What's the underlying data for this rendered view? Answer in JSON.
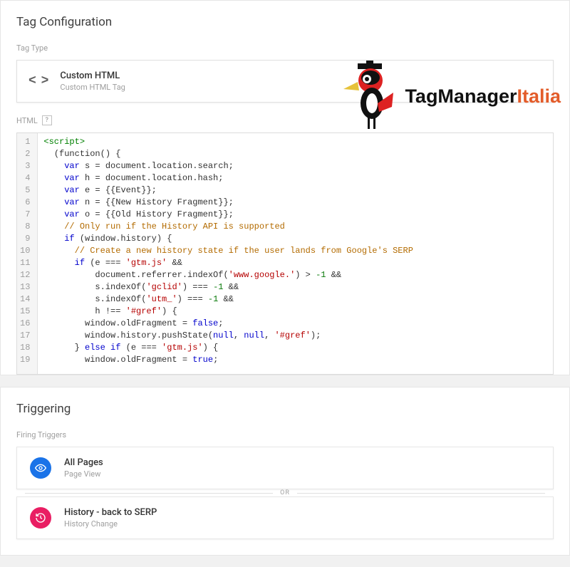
{
  "tag_config": {
    "title": "Tag Configuration",
    "type_label": "Tag Type",
    "type_card": {
      "title": "Custom HTML",
      "subtitle": "Custom HTML Tag"
    },
    "html_label": "HTML",
    "code_lines": [
      [
        {
          "c": "t-tag",
          "t": "<script>"
        }
      ],
      [
        {
          "c": "",
          "t": "  "
        },
        {
          "c": "t-var",
          "t": "(function() {"
        }
      ],
      [
        {
          "c": "",
          "t": "    "
        },
        {
          "c": "t-kw",
          "t": "var"
        },
        {
          "c": "",
          "t": " s = document.location.search;"
        }
      ],
      [
        {
          "c": "",
          "t": "    "
        },
        {
          "c": "t-kw",
          "t": "var"
        },
        {
          "c": "",
          "t": " h = document.location.hash;"
        }
      ],
      [
        {
          "c": "",
          "t": "    "
        },
        {
          "c": "t-kw",
          "t": "var"
        },
        {
          "c": "",
          "t": " e = {{Event}};"
        }
      ],
      [
        {
          "c": "",
          "t": "    "
        },
        {
          "c": "t-kw",
          "t": "var"
        },
        {
          "c": "",
          "t": " n = {{New History Fragment}};"
        }
      ],
      [
        {
          "c": "",
          "t": "    "
        },
        {
          "c": "t-kw",
          "t": "var"
        },
        {
          "c": "",
          "t": " o = {{Old History Fragment}};"
        }
      ],
      [
        {
          "c": "",
          "t": "    "
        },
        {
          "c": "t-cmt",
          "t": "// Only run if the History API is supported"
        }
      ],
      [
        {
          "c": "",
          "t": "    "
        },
        {
          "c": "t-kw",
          "t": "if"
        },
        {
          "c": "",
          "t": " (window.history) {"
        }
      ],
      [
        {
          "c": "",
          "t": "      "
        },
        {
          "c": "t-cmt",
          "t": "// Create a new history state if the user lands from Google's SERP"
        }
      ],
      [
        {
          "c": "",
          "t": "      "
        },
        {
          "c": "t-kw",
          "t": "if"
        },
        {
          "c": "",
          "t": " (e === "
        },
        {
          "c": "t-str",
          "t": "'gtm.js'"
        },
        {
          "c": "",
          "t": " &&"
        }
      ],
      [
        {
          "c": "",
          "t": "          document.referrer.indexOf("
        },
        {
          "c": "t-str",
          "t": "'www.google.'"
        },
        {
          "c": "",
          "t": ") > "
        },
        {
          "c": "t-num",
          "t": "-1"
        },
        {
          "c": "",
          "t": " &&"
        }
      ],
      [
        {
          "c": "",
          "t": "          s.indexOf("
        },
        {
          "c": "t-str",
          "t": "'gclid'"
        },
        {
          "c": "",
          "t": ") === "
        },
        {
          "c": "t-num",
          "t": "-1"
        },
        {
          "c": "",
          "t": " &&"
        }
      ],
      [
        {
          "c": "",
          "t": "          s.indexOf("
        },
        {
          "c": "t-str",
          "t": "'utm_'"
        },
        {
          "c": "",
          "t": ") === "
        },
        {
          "c": "t-num",
          "t": "-1"
        },
        {
          "c": "",
          "t": " &&"
        }
      ],
      [
        {
          "c": "",
          "t": "          h !== "
        },
        {
          "c": "t-str",
          "t": "'#gref'"
        },
        {
          "c": "",
          "t": ") {"
        }
      ],
      [
        {
          "c": "",
          "t": "        window.oldFragment = "
        },
        {
          "c": "t-kw",
          "t": "false"
        },
        {
          "c": "",
          "t": ";"
        }
      ],
      [
        {
          "c": "",
          "t": "        window.history.pushState("
        },
        {
          "c": "t-kw",
          "t": "null"
        },
        {
          "c": "",
          "t": ", "
        },
        {
          "c": "t-kw",
          "t": "null"
        },
        {
          "c": "",
          "t": ", "
        },
        {
          "c": "t-str",
          "t": "'#gref'"
        },
        {
          "c": "",
          "t": ");"
        }
      ],
      [
        {
          "c": "",
          "t": "      } "
        },
        {
          "c": "t-kw",
          "t": "else if"
        },
        {
          "c": "",
          "t": " (e === "
        },
        {
          "c": "t-str",
          "t": "'gtm.js'"
        },
        {
          "c": "",
          "t": ") {"
        }
      ],
      [
        {
          "c": "",
          "t": "        window.oldFragment = "
        },
        {
          "c": "t-kw",
          "t": "true"
        },
        {
          "c": "",
          "t": ";"
        }
      ]
    ]
  },
  "watermark": {
    "text1": "TagManager",
    "text2": "Italia"
  },
  "triggering": {
    "title": "Triggering",
    "firing_label": "Firing Triggers",
    "or_label": "OR",
    "items": [
      {
        "name": "All Pages",
        "type": "Page View",
        "iconClass": "ic-blue"
      },
      {
        "name": "History - back to SERP",
        "type": "History Change",
        "iconClass": "ic-pink"
      }
    ]
  }
}
